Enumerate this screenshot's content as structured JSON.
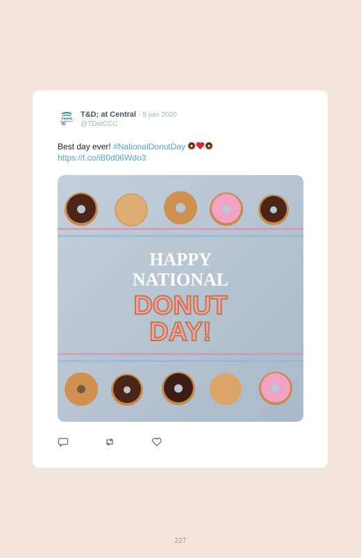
{
  "tweet": {
    "author_name": "T&D; at Central",
    "separator": "·",
    "date": "5 juin 2020",
    "handle": "@TDatCCC",
    "avatar": {
      "logo_text_top": "Central",
      "logo_text_bottom": "TD"
    },
    "text_main": "Best day ever! ",
    "hashtag": "#NationalDonutDay",
    "emojis": [
      "donut",
      "heart",
      "donut"
    ],
    "link": "https://t.co/iB0d06Wdo3",
    "image": {
      "line1": "HAPPY",
      "line2": "NATIONAL",
      "line3": "DONUT",
      "line4": "DAY!"
    },
    "actions": [
      "reply-icon",
      "retweet-icon",
      "like-icon"
    ]
  },
  "page_number": "227",
  "colors": {
    "background": "#f2e6dc",
    "card": "#ffffff",
    "link": "#4fa6d6",
    "image_bg": "#b8c7d4"
  }
}
